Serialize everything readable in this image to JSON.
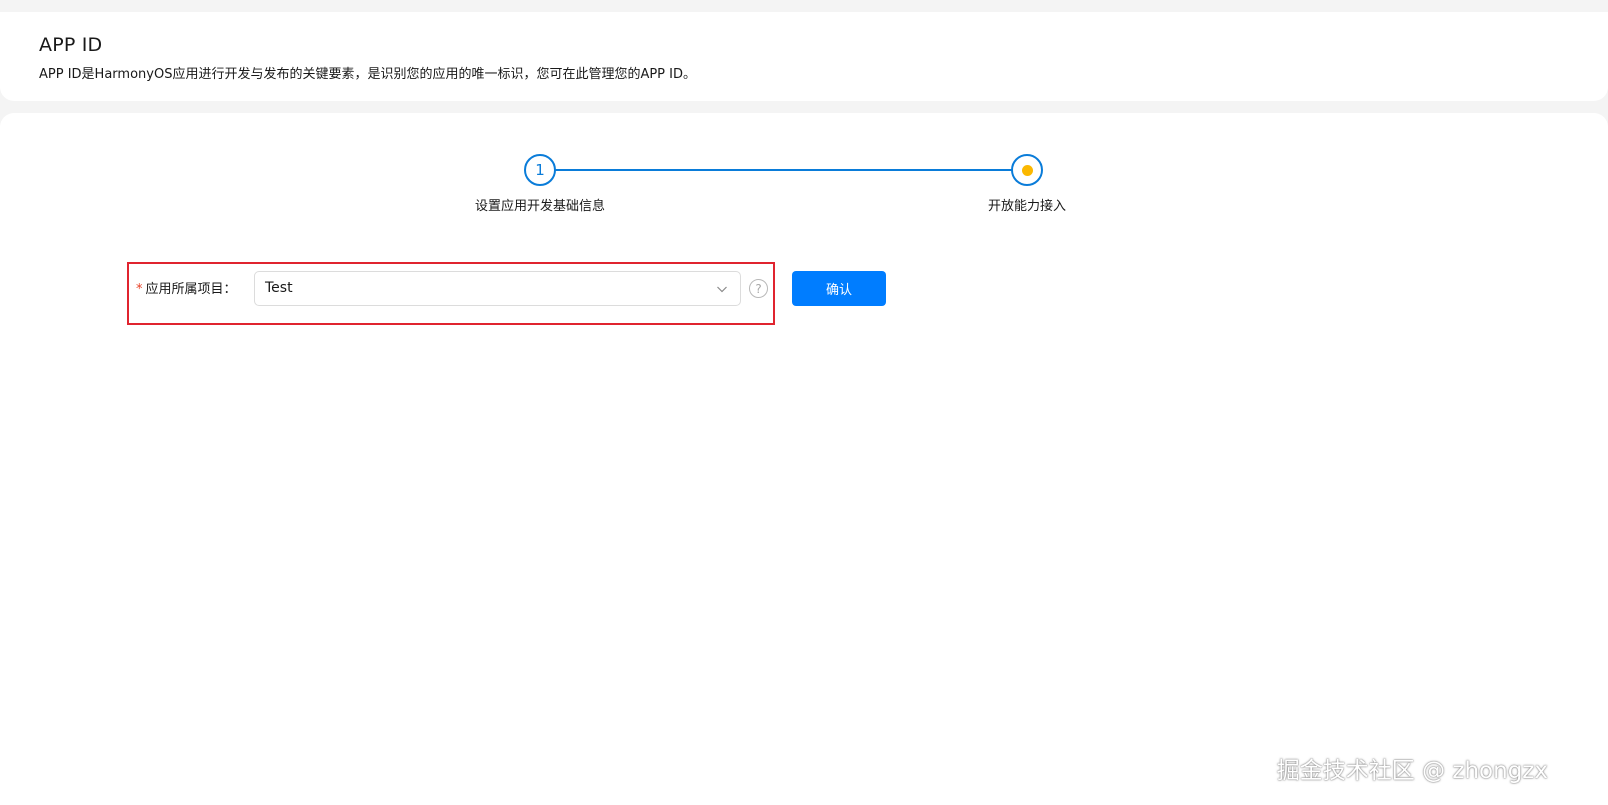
{
  "header": {
    "title": "APP ID",
    "description": "APP ID是HarmonyOS应用进行开发与发布的关键要素，是识别您的应用的唯一标识，您可在此管理您的APP ID。"
  },
  "stepper": {
    "steps": [
      {
        "number": "1",
        "label": "设置应用开发基础信息"
      },
      {
        "number": "",
        "label": "开放能力接入"
      }
    ],
    "colors": {
      "active": "#0a7cd9",
      "current_dot": "#fbb800"
    }
  },
  "form": {
    "project_label": "应用所属项目：",
    "required_mark": "*",
    "project_value": "Test",
    "help_symbol": "?",
    "confirm_label": "确认"
  },
  "watermark": "掘金技术社区 @ zhongzx",
  "colors": {
    "primary": "#007dff",
    "highlight": "#e0242f"
  }
}
